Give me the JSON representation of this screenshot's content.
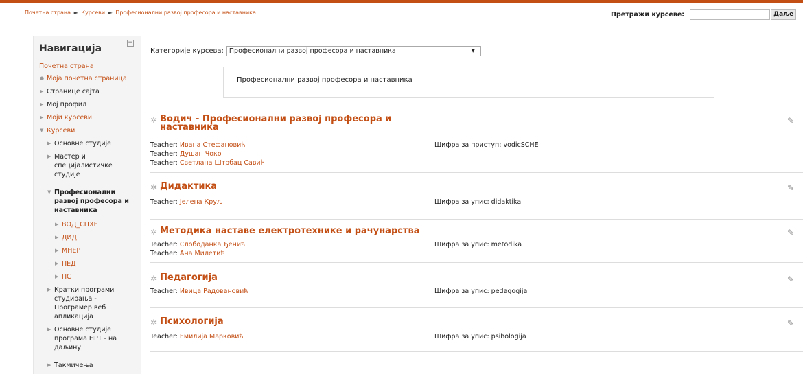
{
  "breadcrumb": {
    "item1": "Почетна страна",
    "sep": "►",
    "item2": "Курсеви",
    "item3": "Професионални развој професора и наставника"
  },
  "search": {
    "label": "Претражи курсеве:",
    "value": "",
    "button": "Даље"
  },
  "nav": {
    "title": "Навигација",
    "collapse": "−",
    "home": "Почетна страна",
    "my_home": "Моја почетна страница",
    "site_pages": "Странице сајта",
    "my_profile": "Мој профил",
    "my_courses": "Моји курсеви",
    "courses": "Курсеви",
    "basic_studies": "Основне студије",
    "master_l1": "Мастер и",
    "master_l2": "специјалистичке",
    "master_l3": "студије",
    "prof_l1": "Професионални",
    "prof_l2": "развој професора и",
    "prof_l3": "наставника",
    "sub1": "ВОД_СЦХЕ",
    "sub2": "ДИД",
    "sub3": "МНЕР",
    "sub4": "ПЕД",
    "sub5": "ПС",
    "short_l1": "Кратки програми",
    "short_l2": "студирања -",
    "short_l3": "Програмер веб",
    "short_l4": "апликација",
    "hrt_l1": "Основне студије",
    "hrt_l2": "програма НРТ - на",
    "hrt_l3": "даљину",
    "comp": "Такмичења"
  },
  "category": {
    "label": "Категорије курсева:",
    "selected": "Професионални развој професора и наставника",
    "arrow": "▼"
  },
  "description": "Професионални развој професора и наставника",
  "courses": [
    {
      "name_l1": "Водич - Професионални развој професора и",
      "name_l2": "наставника",
      "t_label": "Teacher:",
      "t1": "Ивана Стефановић",
      "t2": "Душан Чоко",
      "t3": "Светлана Штрбац Савић",
      "key": "Шифра за приступ: vodicSCHE"
    },
    {
      "name_l1": "Дидактика",
      "t_label": "Teacher:",
      "t1": "Јелена Круљ",
      "key": "Шифра за упис: didaktika"
    },
    {
      "name_l1": "Методика наставе електротехнике и рачунарства",
      "t_label": "Teacher:",
      "t1": "Слободанка Ђенић",
      "t2": "Ана Милетић",
      "key": "Шифра за упис: metodika"
    },
    {
      "name_l1": "Педагогија",
      "t_label": "Teacher:",
      "t1": "Ивица Радовановић",
      "key": "Шифра за упис: pedagogija"
    },
    {
      "name_l1": "Психологија",
      "t_label": "Teacher:",
      "t1": "Емилија Марковић",
      "key": "Шифра за упис: psihologija"
    }
  ],
  "icons": {
    "course": "course-icon",
    "edit": "edit-icon"
  }
}
